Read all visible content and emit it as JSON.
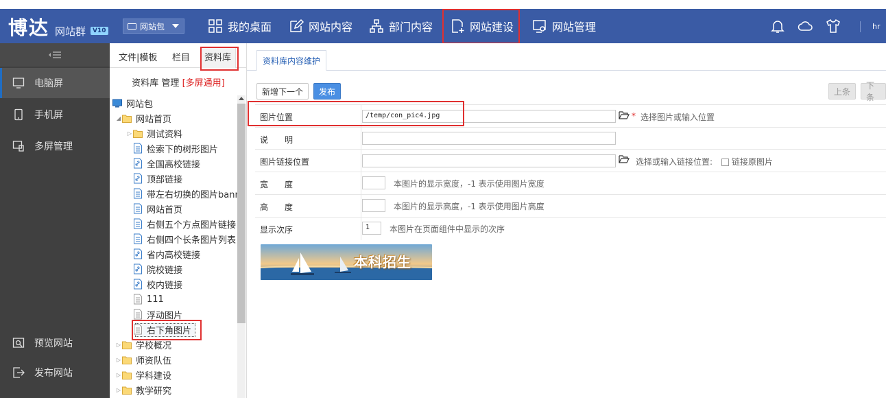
{
  "header": {
    "logo_text": "博达",
    "logo_subtitle": "网站群",
    "logo_version": "V10",
    "package_select": "网站包",
    "nav": [
      {
        "label": "我的桌面",
        "icon": "grid-icon"
      },
      {
        "label": "网站内容",
        "icon": "edit-icon"
      },
      {
        "label": "部门内容",
        "icon": "org-chart-icon"
      },
      {
        "label": "网站建设",
        "icon": "new-page-icon",
        "active": true
      },
      {
        "label": "网站管理",
        "icon": "monitor-settings-icon"
      }
    ],
    "user": "hr"
  },
  "sidebar": {
    "items": [
      {
        "label": "电脑屏",
        "icon": "desktop-icon",
        "active": true
      },
      {
        "label": "手机屏",
        "icon": "mobile-icon"
      },
      {
        "label": "多屏管理",
        "icon": "multiscreen-icon"
      }
    ],
    "bottom": [
      {
        "label": "预览网站",
        "icon": "preview-icon"
      },
      {
        "label": "发布网站",
        "icon": "publish-icon"
      }
    ]
  },
  "tree_panel": {
    "tabs": [
      "文件|模板",
      "栏目",
      "资料库"
    ],
    "active_tab": "资料库",
    "title": "资料库 管理",
    "title_note": "[多屏通用]",
    "tree": [
      {
        "label": "网站包",
        "level": 0,
        "type": "root"
      },
      {
        "label": "网站首页",
        "level": 1,
        "type": "folder",
        "expanded": true
      },
      {
        "label": "测试资料",
        "level": 2,
        "type": "folder",
        "collapsed": true
      },
      {
        "label": "检索下的树形图片",
        "level": 2,
        "type": "doc"
      },
      {
        "label": "全国高校链接",
        "level": 2,
        "type": "link"
      },
      {
        "label": "顶部链接",
        "level": 2,
        "type": "link"
      },
      {
        "label": "带左右切换的图片banner",
        "level": 2,
        "type": "doc"
      },
      {
        "label": "网站首页",
        "level": 2,
        "type": "doc"
      },
      {
        "label": "右侧五个方点图片链接",
        "level": 2,
        "type": "doc"
      },
      {
        "label": "右侧四个长条图片列表",
        "level": 2,
        "type": "doc"
      },
      {
        "label": "省内高校链接",
        "level": 2,
        "type": "link"
      },
      {
        "label": "院校链接",
        "level": 2,
        "type": "link"
      },
      {
        "label": "校内链接",
        "level": 2,
        "type": "link"
      },
      {
        "label": "111",
        "level": 2,
        "type": "text"
      },
      {
        "label": "浮动图片",
        "level": 2,
        "type": "text"
      },
      {
        "label": "右下角图片",
        "level": 2,
        "type": "text",
        "selected": true
      },
      {
        "label": "学校概况",
        "level": 1,
        "type": "folder",
        "collapsed": true
      },
      {
        "label": "师资队伍",
        "level": 1,
        "type": "folder",
        "collapsed": true
      },
      {
        "label": "学科建设",
        "level": 1,
        "type": "folder",
        "collapsed": true
      },
      {
        "label": "教学研究",
        "level": 1,
        "type": "folder",
        "collapsed": true
      }
    ]
  },
  "main": {
    "tab": "资料库内容维护",
    "buttons": {
      "add_next": "新增下一个",
      "publish": "发布",
      "prev": "上条",
      "next": "下条"
    },
    "form": {
      "image_position_label": "图片位置",
      "image_position_value": "/temp/con_pic4.jpg",
      "image_position_hint": "选择图片或输入位置",
      "required_mark": "*",
      "desc_label": "说　　明",
      "desc_value": "",
      "link_label": "图片链接位置",
      "link_value": "",
      "link_hint": "选择或输入链接位置:",
      "link_original_label": "链接原图片",
      "width_label": "宽　　度",
      "width_value": "",
      "width_hint": "本图片的显示宽度，-1 表示使用图片宽度",
      "height_label": "高　　度",
      "height_value": "",
      "height_hint": "本图片的显示高度，-1 表示使用图片高度",
      "order_label": "显示次序",
      "order_value": "1",
      "order_hint": "本图片在页面组件中显示的次序"
    },
    "preview_image_text": "本科招生"
  },
  "colors": {
    "header_bg": "#3a5ba5",
    "sidebar_bg": "#404040",
    "highlight_red": "#e03030",
    "accent_blue": "#4a8fe3"
  }
}
